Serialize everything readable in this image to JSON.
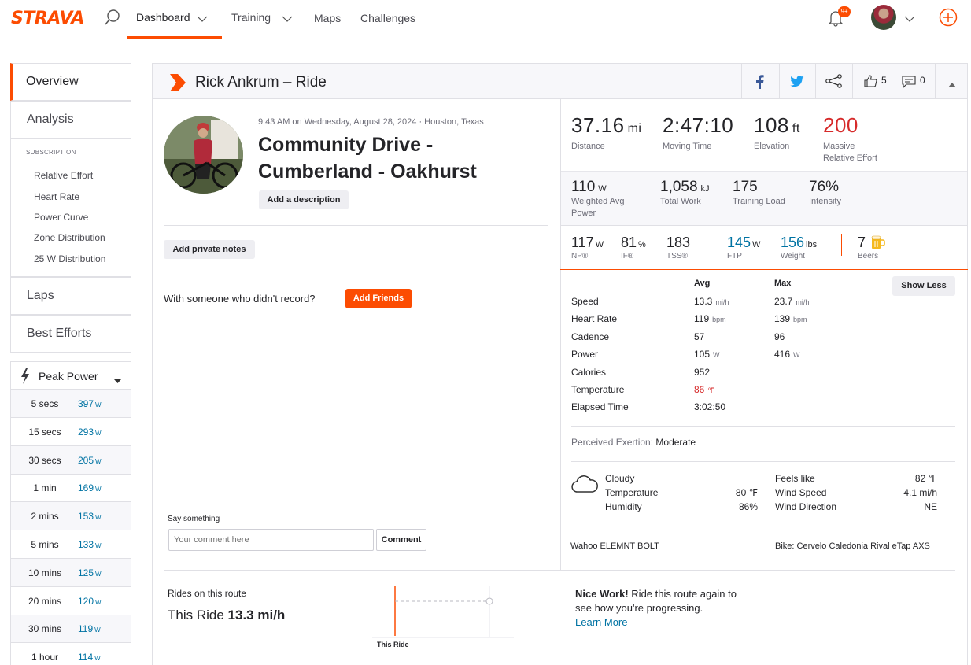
{
  "nav": {
    "logo": "STRAVA",
    "items": [
      {
        "label": "Dashboard"
      },
      {
        "label": "Training"
      },
      {
        "label": "Maps"
      },
      {
        "label": "Challenges"
      }
    ],
    "notification_badge": "9+"
  },
  "sidebar": {
    "tabs": {
      "overview": "Overview",
      "analysis": "Analysis",
      "laps": "Laps",
      "best_efforts": "Best Efforts"
    },
    "subscription_label": "SUBSCRIPTION",
    "subscription_items": [
      "Relative Effort",
      "Heart Rate",
      "Power Curve",
      "Zone Distribution",
      "25 W Distribution"
    ],
    "peak_power": {
      "title": "Peak Power",
      "unit": "W",
      "rows": [
        {
          "time": "5 secs",
          "value": "397"
        },
        {
          "time": "15 secs",
          "value": "293"
        },
        {
          "time": "30 secs",
          "value": "205"
        },
        {
          "time": "1 min",
          "value": "169"
        },
        {
          "time": "2 mins",
          "value": "153"
        },
        {
          "time": "5 mins",
          "value": "133"
        },
        {
          "time": "10 mins",
          "value": "125"
        },
        {
          "time": "20 mins",
          "value": "120"
        },
        {
          "time": "30 mins",
          "value": "119"
        },
        {
          "time": "1 hour",
          "value": "114"
        }
      ]
    }
  },
  "activity": {
    "header_title": "Rick Ankrum – Ride",
    "kudos_count": "5",
    "comment_count": "0",
    "datetime_location": "9:43 AM on Wednesday, August 28, 2024 · Houston, Texas",
    "name_line1": "Community Drive -",
    "name_line2": "Cumberland - Oakhurst",
    "add_description": "Add a description",
    "add_private_notes": "Add private notes",
    "with_someone": "With someone who didn't record?",
    "add_friends": "Add Friends",
    "say_something": "Say something",
    "comment_placeholder": "Your comment here",
    "comment_button": "Comment"
  },
  "stats_primary": [
    {
      "value": "37.16",
      "unit": "mi",
      "label": "Distance"
    },
    {
      "value": "2:47:10",
      "unit": "",
      "label": "Moving Time"
    },
    {
      "value": "108",
      "unit": "ft",
      "label": "Elevation"
    },
    {
      "value": "200",
      "unit": "",
      "label": "Massive",
      "label2": "Relative Effort"
    }
  ],
  "stats_secondary": [
    {
      "value": "110",
      "unit": "W",
      "label": "Weighted Avg",
      "label2": "Power"
    },
    {
      "value": "1,058",
      "unit": "kJ",
      "label": "Total Work"
    },
    {
      "value": "175",
      "unit": "",
      "label": "Training Load"
    },
    {
      "value": "76%",
      "unit": "",
      "label": "Intensity"
    }
  ],
  "stats_tertiary": [
    {
      "value": "117",
      "unit": "W",
      "label": "NP®"
    },
    {
      "value": "81",
      "unit": "%",
      "label": "IF®"
    },
    {
      "value": "183",
      "unit": "",
      "label": "TSS®"
    },
    {
      "value": "145",
      "unit": "W",
      "label": "FTP"
    },
    {
      "value": "156",
      "unit": "lbs",
      "label": "Weight"
    },
    {
      "value": "7",
      "unit": "",
      "label": "Beers"
    }
  ],
  "details": {
    "col_avg": "Avg",
    "col_max": "Max",
    "show_less": "Show Less",
    "rows": [
      {
        "label": "Speed",
        "avg": "13.3",
        "avg_unit": "mi/h",
        "max": "23.7",
        "max_unit": "mi/h"
      },
      {
        "label": "Heart Rate",
        "avg": "119",
        "avg_unit": "bpm",
        "max": "139",
        "max_unit": "bpm"
      },
      {
        "label": "Cadence",
        "avg": "57",
        "avg_unit": "",
        "max": "96",
        "max_unit": ""
      },
      {
        "label": "Power",
        "avg": "105",
        "avg_unit": "W",
        "max": "416",
        "max_unit": "W"
      },
      {
        "label": "Calories",
        "avg": "952",
        "avg_unit": "",
        "max": "",
        "max_unit": ""
      },
      {
        "label": "Temperature",
        "avg": "86",
        "avg_unit": "℉",
        "max": "",
        "max_unit": ""
      },
      {
        "label": "Elapsed Time",
        "avg": "3:02:50",
        "avg_unit": "",
        "max": "",
        "max_unit": ""
      }
    ],
    "perceived_label": "Perceived Exertion:",
    "perceived_value": "Moderate"
  },
  "weather": {
    "condition": "Cloudy",
    "temperature_label": "Temperature",
    "temperature": "80 ℉",
    "humidity_label": "Humidity",
    "humidity": "86%",
    "feels_like_label": "Feels like",
    "feels_like": "82 ℉",
    "wind_speed_label": "Wind Speed",
    "wind_speed": "4.1 mi/h",
    "wind_direction_label": "Wind Direction",
    "wind_direction": "NE"
  },
  "devices": {
    "device": "Wahoo ELEMNT BOLT",
    "bike": "Bike: Cervelo Caledonia Rival eTap AXS"
  },
  "route": {
    "title": "Rides on this route",
    "this_ride_label": "This Ride",
    "this_ride_value": "13.3 mi/h",
    "chart_label": "This Ride",
    "nice_work": "Nice Work!",
    "message": "Ride this route again to see how you're progressing.",
    "learn_more": "Learn More"
  },
  "colors": {
    "brand": "#fc4c02",
    "link": "#0073a3",
    "effort_red": "#d62a2a"
  }
}
